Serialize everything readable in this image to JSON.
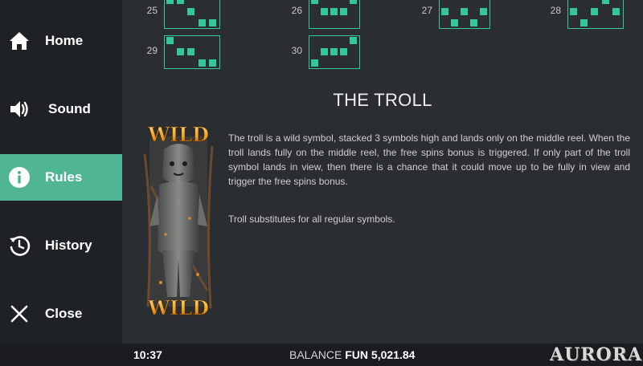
{
  "nav": {
    "items": [
      {
        "label": "Home",
        "icon": "home-icon",
        "active": false
      },
      {
        "label": "Sound",
        "icon": "speaker-icon",
        "active": false
      },
      {
        "label": "Rules",
        "icon": "info-icon",
        "active": true
      },
      {
        "label": "History",
        "icon": "history-icon",
        "active": false
      },
      {
        "label": "Close",
        "icon": "close-icon",
        "active": false
      }
    ]
  },
  "paylines": [
    {
      "number": "25"
    },
    {
      "number": "26"
    },
    {
      "number": "27"
    },
    {
      "number": "28"
    },
    {
      "number": "29"
    },
    {
      "number": "30"
    }
  ],
  "section": {
    "title": "THE TROLL",
    "symbol_text_top": "WILD",
    "symbol_text_bottom": "WILD",
    "paragraph1": "The troll is a wild symbol, stacked 3 symbols high and lands only on the middle reel. When the troll lands fully on the middle reel, the free spins bonus is triggered. If only part of the troll symbol lands in view, then there is a chance that it could move up to be fully in view and trigger the free spins bonus.",
    "paragraph2": "Troll substitutes for all regular symbols."
  },
  "footer": {
    "time": "10:37",
    "balance_label": "BALANCE",
    "balance_currency": "FUN",
    "balance_value": "5,021.84",
    "logo": "AURORA"
  },
  "colors": {
    "accent": "#4fb595",
    "payline": "#34c79a",
    "sidebar": "#1f2225",
    "main_bg": "#2a2d31"
  }
}
